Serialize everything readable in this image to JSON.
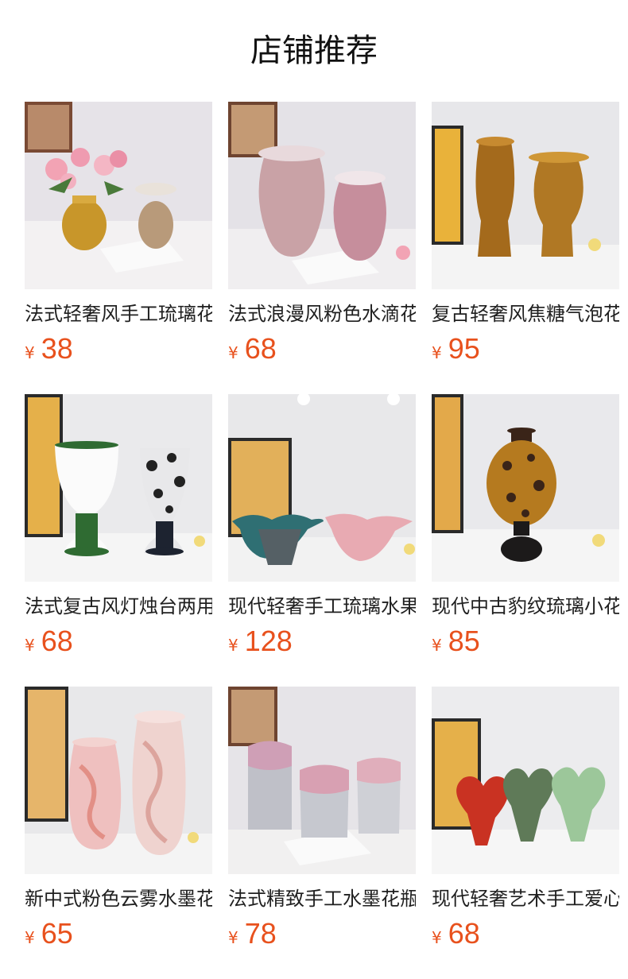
{
  "header": {
    "title": "店铺推荐"
  },
  "currency_symbol": "¥",
  "products": [
    {
      "name": "法式轻奢风手工琉璃花瓶",
      "price": "38",
      "image": "vase-flowers"
    },
    {
      "name": "法式浪漫风粉色水滴花瓶",
      "price": "68",
      "image": "pink-ruffle-vases"
    },
    {
      "name": "复古轻奢风焦糖气泡花瓶",
      "price": "95",
      "image": "amber-vases"
    },
    {
      "name": "法式复古风灯烛台两用花瓶",
      "price": "68",
      "image": "candle-holders"
    },
    {
      "name": "现代轻奢手工琉璃水果盘",
      "price": "128",
      "image": "wave-bowls"
    },
    {
      "name": "现代中古豹纹琉璃小花瓶",
      "price": "85",
      "image": "leopard-vase"
    },
    {
      "name": "新中式粉色云雾水墨花瓶",
      "price": "65",
      "image": "pink-cloud-vases"
    },
    {
      "name": "法式精致手工水墨花瓶",
      "price": "78",
      "image": "ink-vases"
    },
    {
      "name": "现代轻奢艺术手工爱心摆件",
      "price": "68",
      "image": "heart-ornaments"
    }
  ],
  "colors": {
    "price": "#e8511d",
    "title": "#111111"
  }
}
